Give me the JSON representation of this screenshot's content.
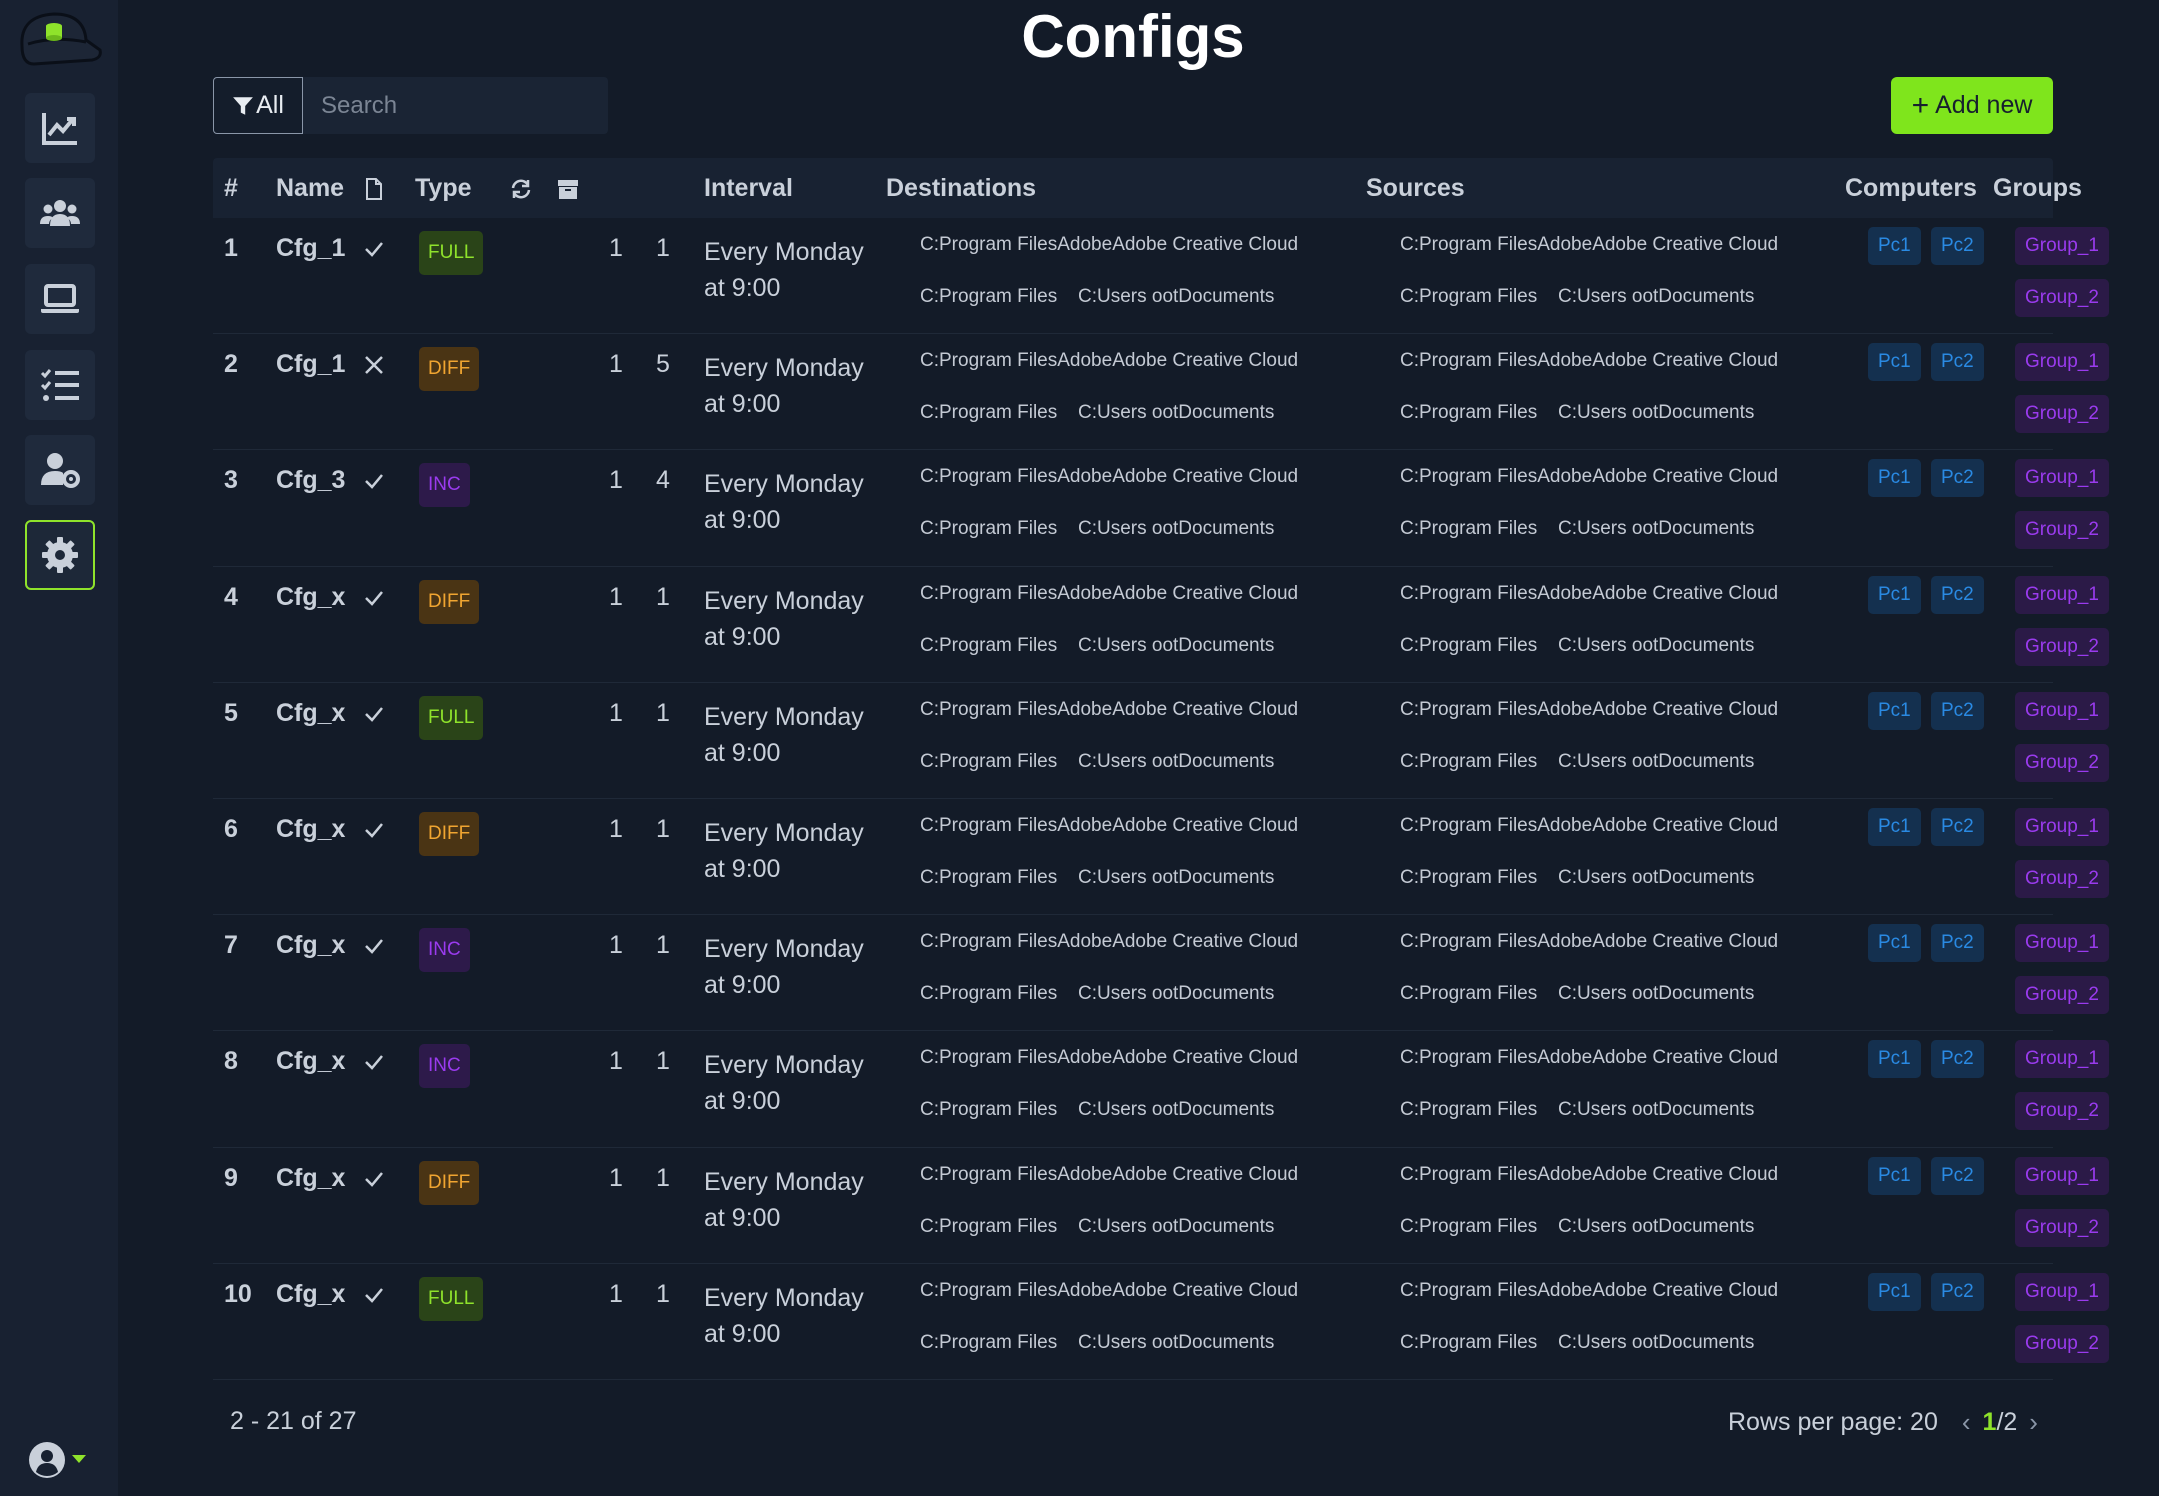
{
  "page": {
    "title": "Configs"
  },
  "toolbar": {
    "filter_label": "All",
    "search_placeholder": "Search",
    "add_label": "Add new"
  },
  "table": {
    "columns": {
      "num": "#",
      "name": "Name",
      "type": "Type",
      "interval": "Interval",
      "destinations": "Destinations",
      "sources": "Sources",
      "computers": "Computers",
      "groups": "Groups"
    },
    "rows": [
      {
        "num": "1",
        "name": "Cfg_1",
        "enabled": true,
        "type": "FULL",
        "retries": "1",
        "keep": "1",
        "interval": "Every Monday at 9:00"
      },
      {
        "num": "2",
        "name": "Cfg_1",
        "enabled": false,
        "type": "DIFF",
        "retries": "1",
        "keep": "5",
        "interval": "Every Monday at 9:00"
      },
      {
        "num": "3",
        "name": "Cfg_3",
        "enabled": true,
        "type": "INC",
        "retries": "1",
        "keep": "4",
        "interval": "Every Monday at 9:00"
      },
      {
        "num": "4",
        "name": "Cfg_x",
        "enabled": true,
        "type": "DIFF",
        "retries": "1",
        "keep": "1",
        "interval": "Every Monday at 9:00"
      },
      {
        "num": "5",
        "name": "Cfg_x",
        "enabled": true,
        "type": "FULL",
        "retries": "1",
        "keep": "1",
        "interval": "Every Monday at 9:00"
      },
      {
        "num": "6",
        "name": "Cfg_x",
        "enabled": true,
        "type": "DIFF",
        "retries": "1",
        "keep": "1",
        "interval": "Every Monday at 9:00"
      },
      {
        "num": "7",
        "name": "Cfg_x",
        "enabled": true,
        "type": "INC",
        "retries": "1",
        "keep": "1",
        "interval": "Every Monday at 9:00"
      },
      {
        "num": "8",
        "name": "Cfg_x",
        "enabled": true,
        "type": "INC",
        "retries": "1",
        "keep": "1",
        "interval": "Every Monday at 9:00"
      },
      {
        "num": "9",
        "name": "Cfg_x",
        "enabled": true,
        "type": "DIFF",
        "retries": "1",
        "keep": "1",
        "interval": "Every Monday at 9:00"
      },
      {
        "num": "10",
        "name": "Cfg_x",
        "enabled": true,
        "type": "FULL",
        "retries": "1",
        "keep": "1",
        "interval": "Every Monday at 9:00"
      }
    ],
    "paths": [
      "C:Program FilesAdobeAdobe Creative Cloud",
      "C:Program Files",
      "C:Users ootDocuments"
    ],
    "computers": [
      "Pc1",
      "Pc2"
    ],
    "groups": [
      "Group_1",
      "Group_2"
    ]
  },
  "footer": {
    "count": "2 - 21 of 27",
    "rows_per_page": "Rows per page: 20",
    "page_current": "1",
    "page_total": "/2"
  },
  "colors": {
    "accent": "#8fe32b",
    "full": "#8fe32b",
    "diff": "#f0a531",
    "inc": "#9a3bee",
    "computer": "#2a8ae3"
  },
  "icons": {
    "nav": [
      "chart-line-icon",
      "users-icon",
      "laptop-icon",
      "tasks-icon",
      "user-cog-icon",
      "gear-icon"
    ]
  }
}
